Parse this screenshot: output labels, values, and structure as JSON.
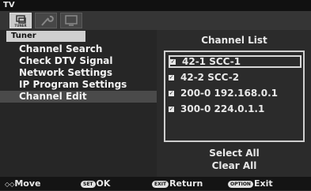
{
  "window": {
    "title": "TV"
  },
  "iconbar": {
    "icons": [
      "tuner-icon",
      "wrench-icon",
      "screen-icon"
    ],
    "active_label": "TUNER"
  },
  "left": {
    "header": "Tuner",
    "items": [
      "Channel Search",
      "Check DTV Signal",
      "Network Settings",
      "IP Program Settings",
      "Channel Edit"
    ],
    "selected_index": 4
  },
  "right": {
    "title": "Channel List",
    "channels": [
      "42-1 SCC-1",
      "42-2 SCC-2",
      "200-0 192.168.0.1",
      "300-0 224.0.1.1"
    ],
    "focused_index": 0,
    "select_all": "Select All",
    "clear_all": "Clear All"
  },
  "footer": {
    "move": {
      "key": "◇◇",
      "label": "Move"
    },
    "ok": {
      "key": "SET",
      "label": "OK"
    },
    "return": {
      "key": "EXIT",
      "label": "Return"
    },
    "exit": {
      "key": "OPTION",
      "label": "Exit"
    }
  }
}
